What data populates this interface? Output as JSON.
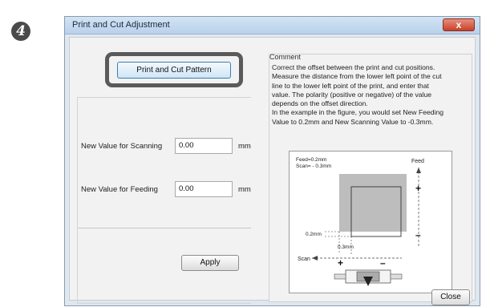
{
  "step_number": "4",
  "dialog": {
    "title": "Print and Cut Adjustment",
    "close_glyph": "x",
    "pattern_button": "Print and Cut Pattern",
    "scanning": {
      "label": "New Value for Scanning",
      "value": "0.00",
      "unit": "mm"
    },
    "feeding": {
      "label": "New Value for Feeding",
      "value": "0.00",
      "unit": "mm"
    },
    "apply_button": "Apply",
    "close_button": "Close"
  },
  "comment": {
    "title": "Comment",
    "lines": [
      "Correct the offset between the print and cut positions.",
      "Measure the distance from the lower left point of the cut",
      "line to the lower left point of the print, and enter that",
      "value. The polarity (positive or negative) of the value",
      "depends on the offset direction.",
      "In the example in the figure, you would set New Feeding",
      "Value to 0.2mm and New Scanning Value to -0.3mm."
    ]
  },
  "figure": {
    "feed_value_label": "Feed=0.2mm",
    "scan_value_label": "Scan= - 0.3mm",
    "feed_axis_label": "Feed",
    "scan_axis_label": "Scan",
    "plus": "+",
    "minus": "–",
    "dim_02": "0.2mm",
    "dim_03": "0.3mm"
  },
  "colors": {
    "titlebar": "#c9dcf0",
    "close": "#d0553e",
    "dialog_bg": "#f2f2f2",
    "print_gray": "#bdbdbd"
  }
}
